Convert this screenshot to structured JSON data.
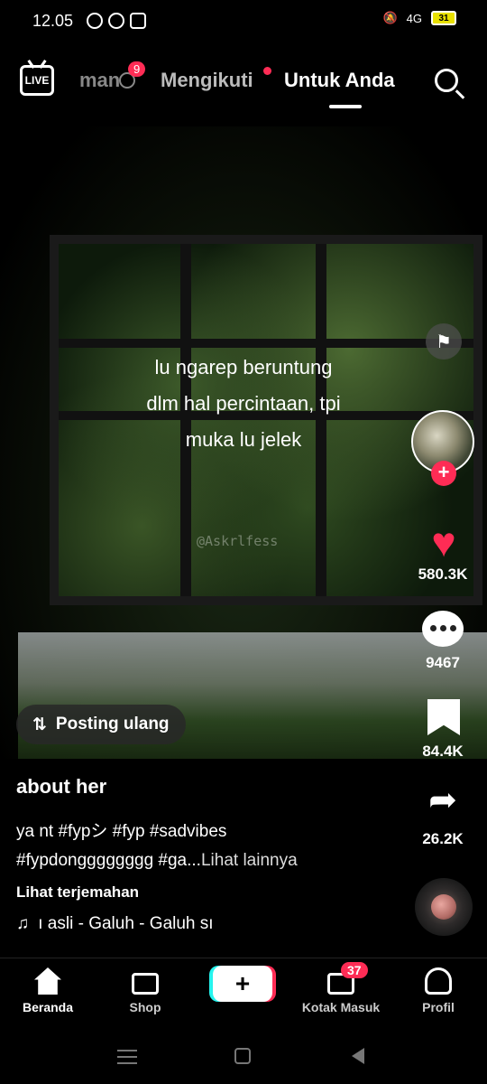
{
  "status_bar": {
    "time": "12.05",
    "network": "4G",
    "battery": "31"
  },
  "top_nav": {
    "live_label": "LIVE",
    "tabs": [
      {
        "label": "man"
      },
      {
        "label": "Mengikuti"
      },
      {
        "label": "Untuk Anda"
      }
    ],
    "friends_badge": "9"
  },
  "video": {
    "overlay_lines": [
      "lu ngarep beruntung",
      "dlm hal percintaan, tpi",
      "muka lu jelek"
    ],
    "watermark": "@Askrlfess"
  },
  "actions": {
    "likes": "580.3K",
    "comments": "9467",
    "saves": "84.4K",
    "shares": "26.2K"
  },
  "repost": {
    "label": "Posting ulang"
  },
  "post": {
    "author": "about her",
    "caption_line1": "ya nt #fypシ #fyp #sadvibes",
    "caption_line2": "#fypdongggggggg #ga...",
    "see_more": "Lihat lainnya",
    "translate": "Lihat terjemahan",
    "music": "ı asli - Galuh - Galuh    sı"
  },
  "bottom_nav": {
    "items": [
      {
        "label": "Beranda"
      },
      {
        "label": "Shop"
      },
      {
        "label": "Kotak Masuk"
      },
      {
        "label": "Profil"
      }
    ],
    "create_label": "+",
    "inbox_badge": "37"
  },
  "colors": {
    "accent": "#fe2c55",
    "cyan": "#25f4ee"
  },
  "icons": [
    "live-icon",
    "info-icon",
    "search-icon",
    "flag-icon",
    "heart-icon",
    "comment-icon",
    "bookmark-icon",
    "share-icon",
    "repost-icon",
    "music-note-icon",
    "home-icon",
    "shop-icon",
    "inbox-icon",
    "profile-icon"
  ]
}
